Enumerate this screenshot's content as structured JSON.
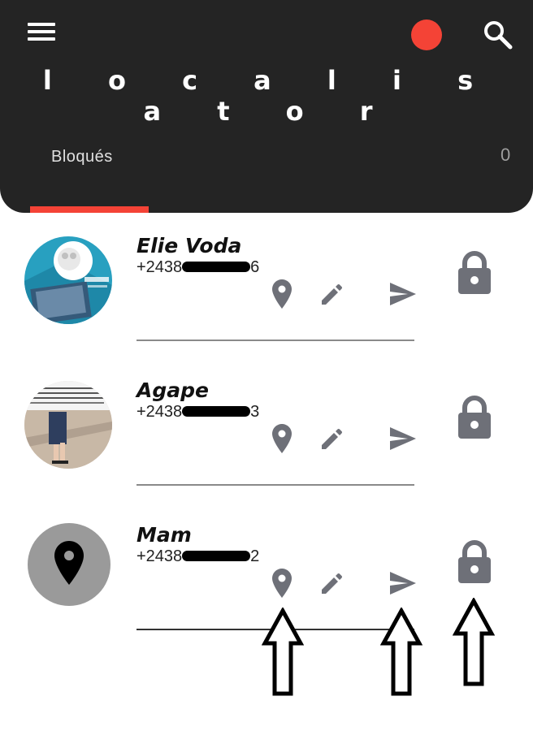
{
  "app": {
    "title": "l o c a l i s a t o r"
  },
  "header": {
    "menu_icon": "menu-icon",
    "status_color": "#f44336",
    "search_icon": "search-icon"
  },
  "tabs": [
    {
      "label": "Bloqués",
      "selected": true
    }
  ],
  "tab_count": "0",
  "colors": {
    "appbar": "#242424",
    "accent": "#f44336",
    "icon_gray": "#6e7078"
  },
  "contacts": [
    {
      "name": "Elie Voda",
      "phone_prefix": "+2438",
      "phone_suffix": "6",
      "avatar": "photo"
    },
    {
      "name": "Agape",
      "phone_prefix": "+2438",
      "phone_suffix": "3",
      "avatar": "photo"
    },
    {
      "name": "Mam",
      "phone_prefix": "+2438",
      "phone_suffix": "2",
      "avatar": "location-placeholder"
    }
  ],
  "row_actions": [
    "location-icon",
    "edit-icon",
    "send-icon"
  ],
  "row_trailing": "lock-icon"
}
